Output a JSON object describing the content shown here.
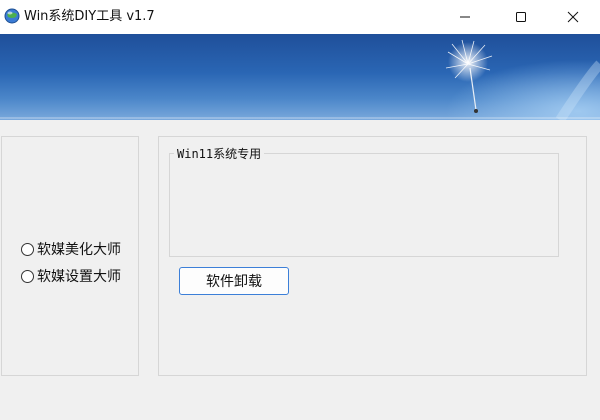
{
  "window": {
    "title": "Win系统DIY工具 v1.7",
    "icon": "app-globe-icon",
    "controls": [
      "minimize-icon",
      "maximize-icon",
      "close-icon"
    ]
  },
  "banner": {
    "decoration": "dandelion-seed-image",
    "colors": {
      "top": "#1f4f9a",
      "bottom": "#7aa9dc"
    }
  },
  "left_panel": {
    "options": [
      {
        "label": "软媒美化大师",
        "selected": false
      },
      {
        "label": "软媒设置大师",
        "selected": false
      }
    ]
  },
  "right_panel": {
    "group_title": "Win11系统专用",
    "uninstall_label": "软件卸载"
  },
  "colors": {
    "background": "#f0f0f0",
    "button_border": "#3c7fd8",
    "panel_border": "#d6d6d6"
  }
}
